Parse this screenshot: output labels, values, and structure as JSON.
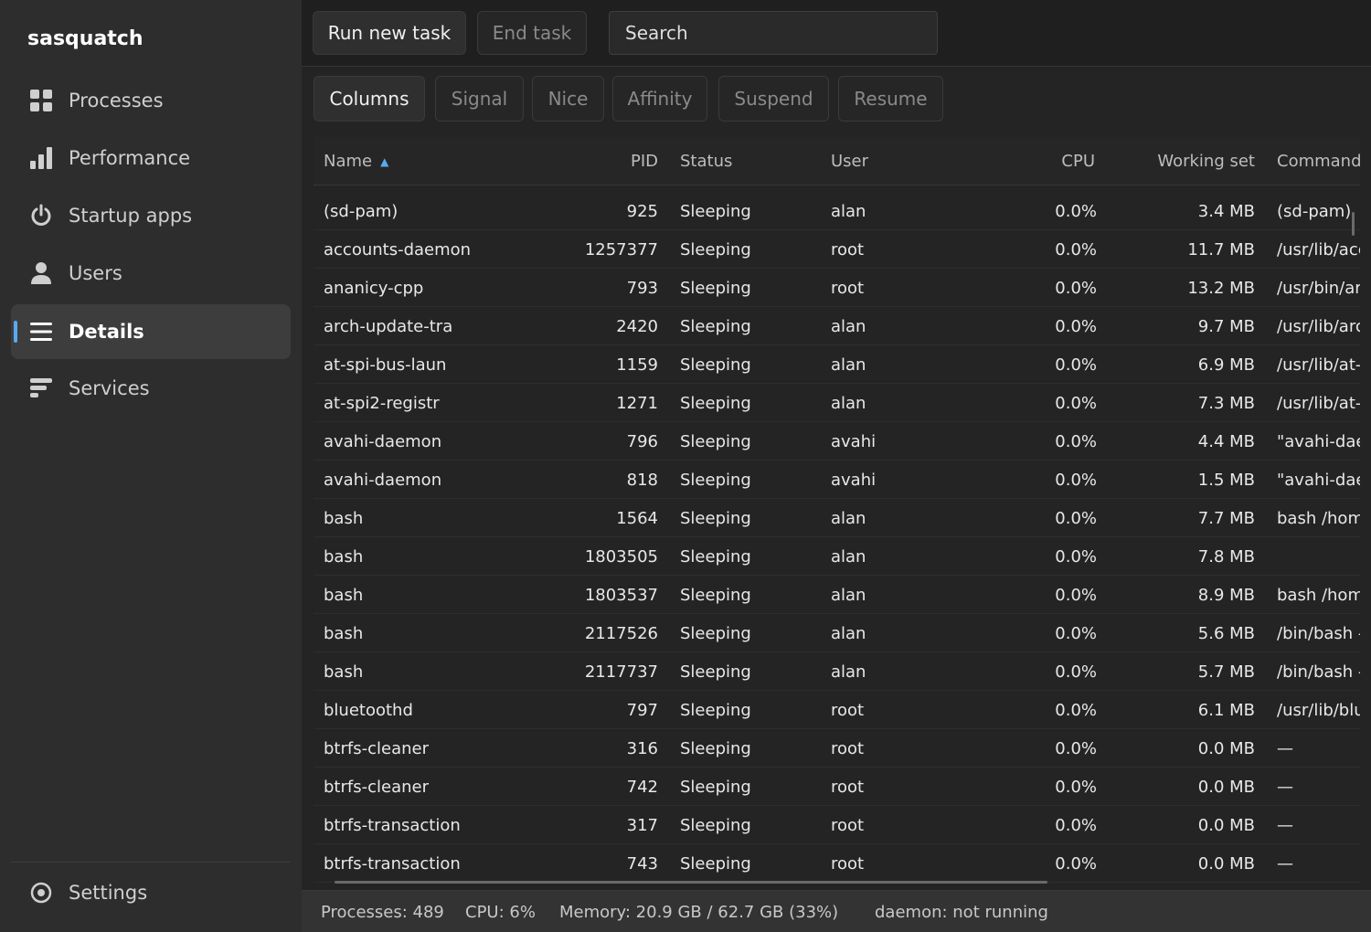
{
  "app": {
    "title": "sasquatch"
  },
  "sidebar": {
    "items": [
      {
        "label": "Processes",
        "icon": "grid-icon",
        "active": false
      },
      {
        "label": "Performance",
        "icon": "bar-chart-icon",
        "active": false
      },
      {
        "label": "Startup apps",
        "icon": "power-icon",
        "active": false
      },
      {
        "label": "Users",
        "icon": "user-icon",
        "active": false
      },
      {
        "label": "Details",
        "icon": "list-icon",
        "active": true
      },
      {
        "label": "Services",
        "icon": "services-icon",
        "active": false
      }
    ],
    "settings_label": "Settings"
  },
  "toolbar": {
    "run_new_task": "Run new task",
    "end_task": "End task",
    "search_placeholder": "Search"
  },
  "subtoolbar": {
    "columns": "Columns",
    "signal": "Signal",
    "nice": "Nice",
    "affinity": "Affinity",
    "suspend": "Suspend",
    "resume": "Resume"
  },
  "table": {
    "headers": {
      "name": "Name",
      "pid": "PID",
      "status": "Status",
      "user": "User",
      "cpu": "CPU",
      "working_set": "Working set",
      "command": "Command"
    },
    "sort": {
      "column": "name",
      "direction": "ascending"
    },
    "rows": [
      {
        "name": "(sd-pam)",
        "pid": "925",
        "status": "Sleeping",
        "user": "alan",
        "cpu": "0.0%",
        "ws": "3.4 MB",
        "cmd": "(sd-pam)"
      },
      {
        "name": "accounts-daemon",
        "pid": "1257377",
        "status": "Sleeping",
        "user": "root",
        "cpu": "0.0%",
        "ws": "11.7 MB",
        "cmd": "/usr/lib/acc"
      },
      {
        "name": "ananicy-cpp",
        "pid": "793",
        "status": "Sleeping",
        "user": "root",
        "cpu": "0.0%",
        "ws": "13.2 MB",
        "cmd": "/usr/bin/ar"
      },
      {
        "name": "arch-update-tra",
        "pid": "2420",
        "status": "Sleeping",
        "user": "alan",
        "cpu": "0.0%",
        "ws": "9.7 MB",
        "cmd": "/usr/lib/arc"
      },
      {
        "name": "at-spi-bus-laun",
        "pid": "1159",
        "status": "Sleeping",
        "user": "alan",
        "cpu": "0.0%",
        "ws": "6.9 MB",
        "cmd": "/usr/lib/at-"
      },
      {
        "name": "at-spi2-registr",
        "pid": "1271",
        "status": "Sleeping",
        "user": "alan",
        "cpu": "0.0%",
        "ws": "7.3 MB",
        "cmd": "/usr/lib/at-"
      },
      {
        "name": "avahi-daemon",
        "pid": "796",
        "status": "Sleeping",
        "user": "avahi",
        "cpu": "0.0%",
        "ws": "4.4 MB",
        "cmd": "\"avahi-daer"
      },
      {
        "name": "avahi-daemon",
        "pid": "818",
        "status": "Sleeping",
        "user": "avahi",
        "cpu": "0.0%",
        "ws": "1.5 MB",
        "cmd": "\"avahi-daer"
      },
      {
        "name": "bash",
        "pid": "1564",
        "status": "Sleeping",
        "user": "alan",
        "cpu": "0.0%",
        "ws": "7.7 MB",
        "cmd": "bash /hom"
      },
      {
        "name": "bash",
        "pid": "1803505",
        "status": "Sleeping",
        "user": "alan",
        "cpu": "0.0%",
        "ws": "7.8 MB",
        "cmd": ""
      },
      {
        "name": "bash",
        "pid": "1803537",
        "status": "Sleeping",
        "user": "alan",
        "cpu": "0.0%",
        "ws": "8.9 MB",
        "cmd": "bash /hom"
      },
      {
        "name": "bash",
        "pid": "2117526",
        "status": "Sleeping",
        "user": "alan",
        "cpu": "0.0%",
        "ws": "5.6 MB",
        "cmd": "/bin/bash -"
      },
      {
        "name": "bash",
        "pid": "2117737",
        "status": "Sleeping",
        "user": "alan",
        "cpu": "0.0%",
        "ws": "5.7 MB",
        "cmd": "/bin/bash -"
      },
      {
        "name": "bluetoothd",
        "pid": "797",
        "status": "Sleeping",
        "user": "root",
        "cpu": "0.0%",
        "ws": "6.1 MB",
        "cmd": "/usr/lib/blu"
      },
      {
        "name": "btrfs-cleaner",
        "pid": "316",
        "status": "Sleeping",
        "user": "root",
        "cpu": "0.0%",
        "ws": "0.0 MB",
        "cmd": "—"
      },
      {
        "name": "btrfs-cleaner",
        "pid": "742",
        "status": "Sleeping",
        "user": "root",
        "cpu": "0.0%",
        "ws": "0.0 MB",
        "cmd": "—"
      },
      {
        "name": "btrfs-transaction",
        "pid": "317",
        "status": "Sleeping",
        "user": "root",
        "cpu": "0.0%",
        "ws": "0.0 MB",
        "cmd": "—"
      },
      {
        "name": "btrfs-transaction",
        "pid": "743",
        "status": "Sleeping",
        "user": "root",
        "cpu": "0.0%",
        "ws": "0.0 MB",
        "cmd": "—"
      }
    ]
  },
  "statusbar": {
    "processes": "Processes: 489",
    "cpu": "CPU: 6%",
    "memory": "Memory: 20.9 GB / 62.7 GB (33%)",
    "daemon": "daemon: not running"
  },
  "colors": {
    "accent": "#5aa9f0",
    "sidebar_bg": "#2d2d2d",
    "main_bg": "#242424",
    "toolbar_bg": "#1f1f1f"
  }
}
